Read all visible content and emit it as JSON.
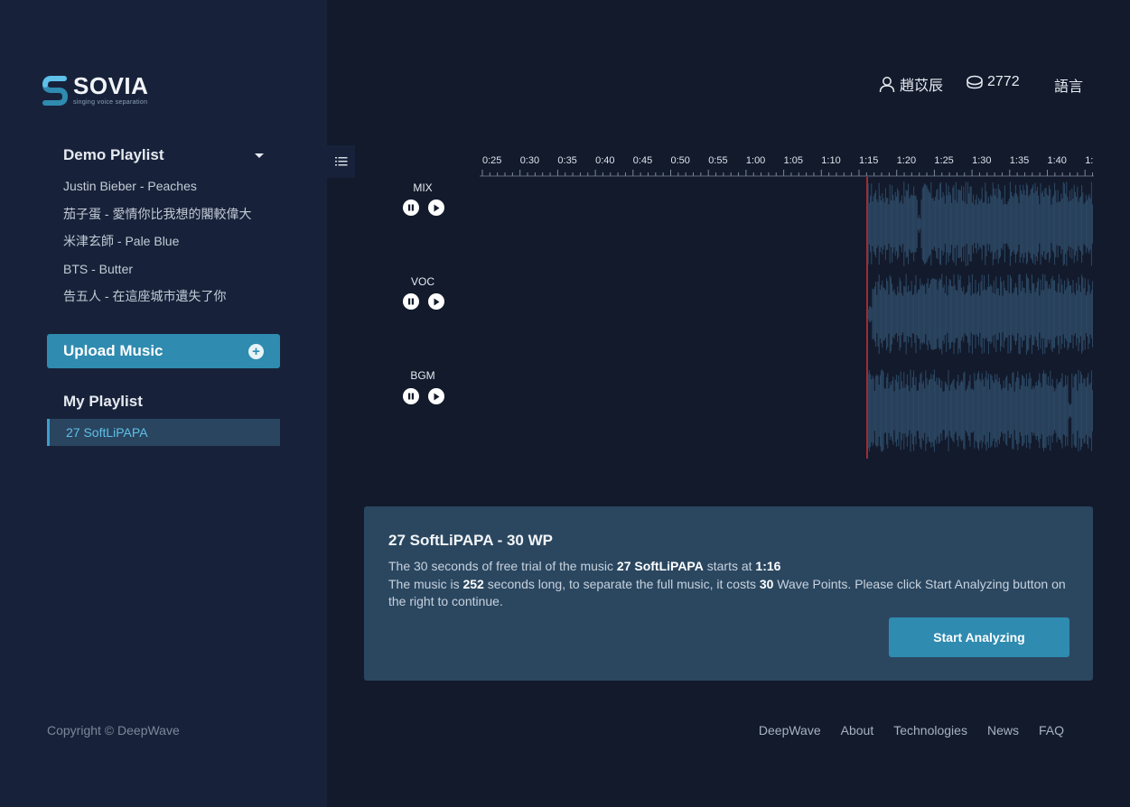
{
  "brand": {
    "name": "SOVIA",
    "tagline": "singing voice separation",
    "colors": {
      "accent": "#2f8bb0",
      "sidebar": "#17223a",
      "background": "#121a2c",
      "panel": "#2b4760",
      "wave": "#2e4a66",
      "playhead": "#a02c35",
      "active": "#5fc0e8"
    }
  },
  "header": {
    "user_icon": "user-icon",
    "user_name": "趙苡辰",
    "points_icon": "coin-icon",
    "points": "2772",
    "language": "語言"
  },
  "sidebar": {
    "demo_title": "Demo Playlist",
    "demo_items": [
      "Justin Bieber - Peaches",
      "茄子蛋 - 愛情你比我想的閣較偉大",
      "米津玄師 - Pale Blue",
      "BTS - Butter",
      "告五人 - 在這座城市遺失了你"
    ],
    "upload_label": "Upload Music",
    "upload_icon": "plus-circle-icon",
    "my_title": "My Playlist",
    "my_items": [
      "27 SoftLiPAPA"
    ],
    "copyright": "Copyright © DeepWave"
  },
  "player": {
    "menu_icon": "list-icon",
    "timeline_labels": [
      "0:25",
      "0:30",
      "0:35",
      "0:40",
      "0:45",
      "0:50",
      "0:55",
      "1:00",
      "1:05",
      "1:10",
      "1:15",
      "1:20",
      "1:25",
      "1:30",
      "1:35",
      "1:40",
      "1:"
    ],
    "tracks": [
      {
        "label": "MIX"
      },
      {
        "label": "VOC"
      },
      {
        "label": "BGM"
      }
    ]
  },
  "info": {
    "title": "27 SoftLiPAPA - 30 WP",
    "line1_prefix": "The 30 seconds of free trial of the music ",
    "line1_song": "27 SoftLiPAPA",
    "line1_mid": " starts at ",
    "line1_time": "1:16",
    "line2_prefix": "The music is ",
    "line2_seconds": "252",
    "line2_mid": " seconds long, to separate the full music, it costs ",
    "line2_points": "30",
    "line2_suffix": " Wave Points. Please click Start Analyzing button on the right to continue.",
    "button": "Start Analyzing"
  },
  "footer": {
    "links": [
      "DeepWave",
      "About",
      "Technologies",
      "News",
      "FAQ"
    ]
  }
}
